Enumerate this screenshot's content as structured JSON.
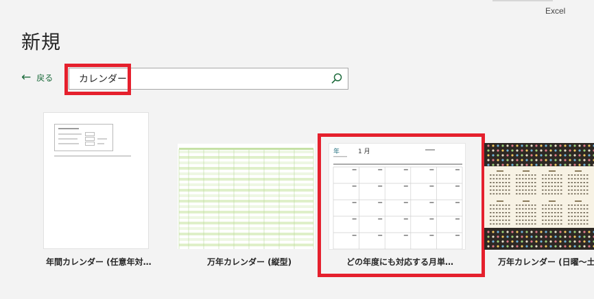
{
  "app": {
    "name": "Excel"
  },
  "page": {
    "title": "新規",
    "back_label": "戻る"
  },
  "search": {
    "value": "カレンダー",
    "placeholder": ""
  },
  "templates": [
    {
      "title": "年間カレンダー (任意年対…"
    },
    {
      "title": "万年カレンダー (縦型)"
    },
    {
      "title": "どの年度にも対応する月単…",
      "thumb": {
        "year_label": "年",
        "month_label": "1 月"
      }
    },
    {
      "title": "万年カレンダー (日曜～土…"
    }
  ],
  "colors": {
    "accent": "#1d6b3c",
    "highlight": "#e5202d"
  },
  "icons": {
    "back": "arrow-left-icon",
    "search": "search-icon"
  }
}
